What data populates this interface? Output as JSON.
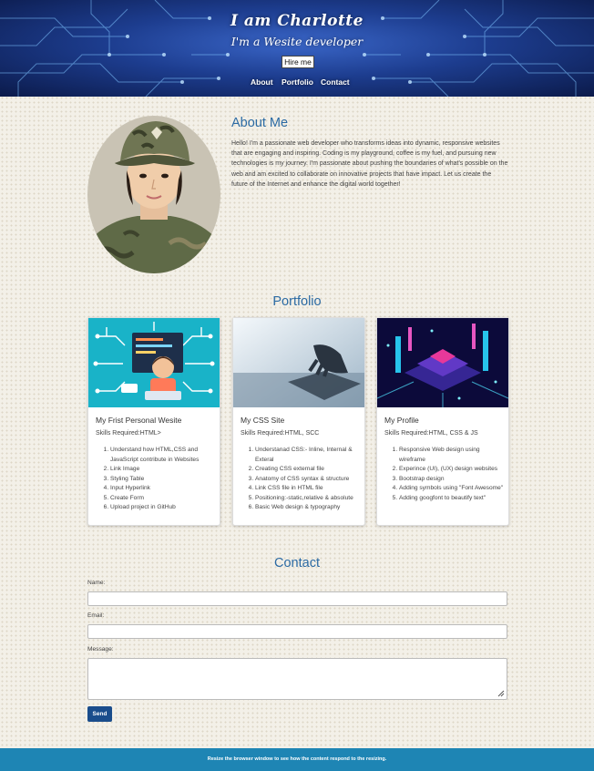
{
  "header": {
    "title": "I am Charlotte",
    "subtitle": "I'm a Wesite developer",
    "hire_label": "Hire me",
    "nav": [
      "About",
      "Portfolio",
      "Contact"
    ]
  },
  "about": {
    "title": "About Me",
    "text": "Hello! I'm a passionate web developer who transforms ideas into dynamic, responsive websites that are engaging and inspiring. Coding is my playground, coffee is my fuel, and pursuing new technologies is my journey. I'm passionate about pushing the boundaries of what's possible on the web and am excited to collaborate on innovative projects that have impact. Let us create the future of the Internet and enhance the digital world together!"
  },
  "portfolio": {
    "title": "Portfolio",
    "cards": [
      {
        "title": "My Frist Personal Wesite",
        "skills": "Skills Required:HTML>",
        "items": [
          "Understand how HTML,CSS and JavaScript contribute in Websites",
          "Link Image",
          "Styling Table",
          "Input Hyperlink",
          "Create Form",
          "Upload project in GitHub"
        ]
      },
      {
        "title": "My CSS Site",
        "skills": "Skills Required:HTML, SCC",
        "items": [
          "Understanad CSS:- Inline, Internal & Exteral",
          "Creating CSS external file",
          "Anatomy of CSS syntax & structure",
          "Link CSS file in HTML file",
          "Positioning:-static,relative & absolute",
          "Basic Web design & typography"
        ]
      },
      {
        "title": "My Profile",
        "skills": "Skills Required:HTML, CSS & JS",
        "items": [
          "Responsive Web design using wireframe",
          "Experince (UI), (UX) design websites",
          "Bootstrap design",
          "Adding symbols using \"Font Awesome\"",
          "Adding googfont to beautify text\""
        ]
      }
    ]
  },
  "contact": {
    "title": "Contact",
    "name_label": "Name:",
    "email_label": "Email:",
    "message_label": "Message:",
    "send_label": "Send"
  },
  "footer": {
    "text": "Resize the browser window to see how the content respond to the resizing."
  },
  "colors": {
    "accent": "#2b6aa3",
    "button": "#1a4d8c",
    "footer": "#1e85b4"
  }
}
